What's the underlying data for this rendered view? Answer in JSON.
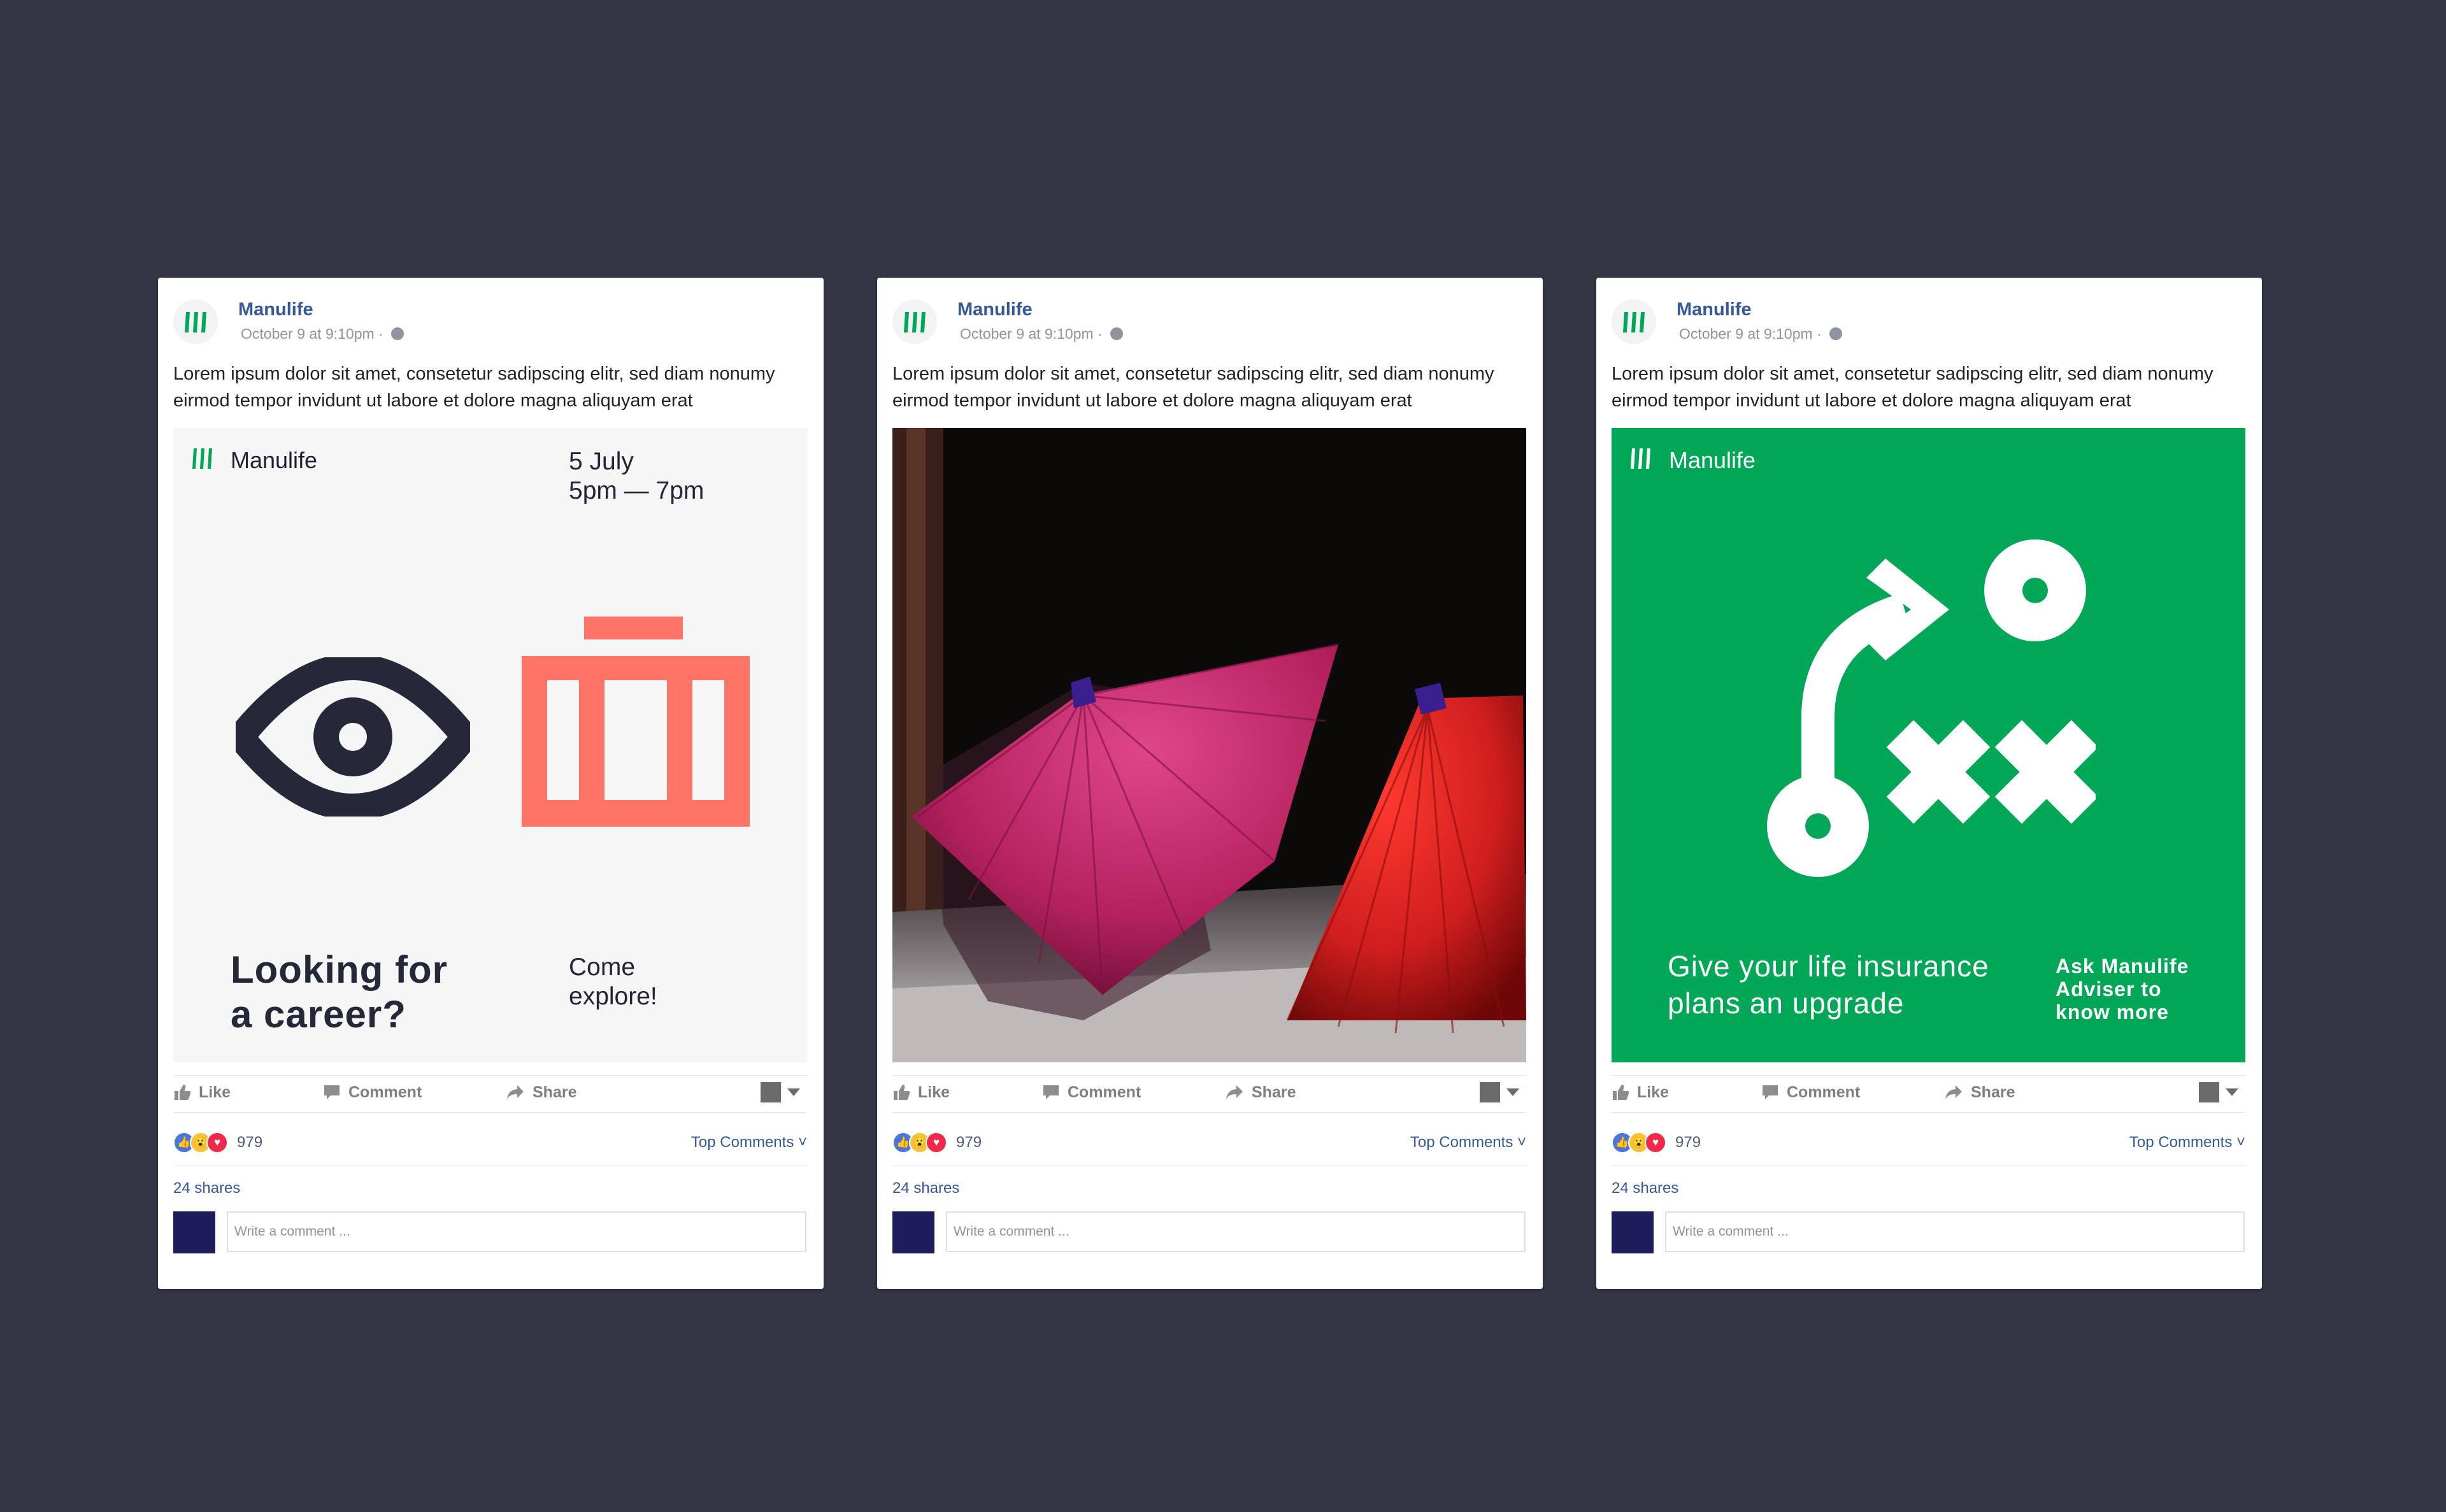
{
  "posts": [
    {
      "page_name": "Manulife",
      "timestamp": "October 9 at 9:10pm",
      "text": "Lorem ipsum dolor sit amet, consetetur sadipscing elitr, sed diam nonumy eirmod tempor invidunt ut labore et dolore magna aliquyam erat",
      "creative": {
        "brand": "Manulife",
        "date_line1": "5 July",
        "date_line2": "5pm — 7pm",
        "headline_line1": "Looking for",
        "headline_line2": "a career?",
        "cta_line1": "Come",
        "cta_line2": "explore!"
      },
      "actions": {
        "like": "Like",
        "comment": "Comment",
        "share": "Share"
      },
      "reaction_count": "979",
      "top_comments": "Top Comments ˅",
      "shares": "24 shares",
      "comment_placeholder": "Write a comment ..."
    },
    {
      "page_name": "Manulife",
      "timestamp": "October 9 at 9:10pm",
      "text": "Lorem ipsum dolor sit amet, consetetur sadipscing elitr, sed diam nonumy eirmod tempor invidunt ut labore et dolore magna aliquyam erat",
      "actions": {
        "like": "Like",
        "comment": "Comment",
        "share": "Share"
      },
      "reaction_count": "979",
      "top_comments": "Top Comments ˅",
      "shares": "24 shares",
      "comment_placeholder": "Write a comment ..."
    },
    {
      "page_name": "Manulife",
      "timestamp": "October 9 at 9:10pm",
      "text": "Lorem ipsum dolor sit amet, consetetur sadipscing elitr, sed diam nonumy eirmod tempor invidunt ut labore et dolore magna aliquyam erat",
      "creative": {
        "brand": "Manulife",
        "headline_line1": "Give your life insurance",
        "headline_line2": "plans an upgrade",
        "cta_line1": "Ask Manulife",
        "cta_line2": "Adviser to",
        "cta_line3": "know more"
      },
      "actions": {
        "like": "Like",
        "comment": "Comment",
        "share": "Share"
      },
      "reaction_count": "979",
      "top_comments": "Top Comments ˅",
      "shares": "24 shares",
      "comment_placeholder": "Write a comment ..."
    }
  ],
  "colors": {
    "background": "#343646",
    "manulife_green": "#00a756",
    "coral": "#ff7466",
    "navy": "#252838",
    "link_blue": "#365899"
  }
}
